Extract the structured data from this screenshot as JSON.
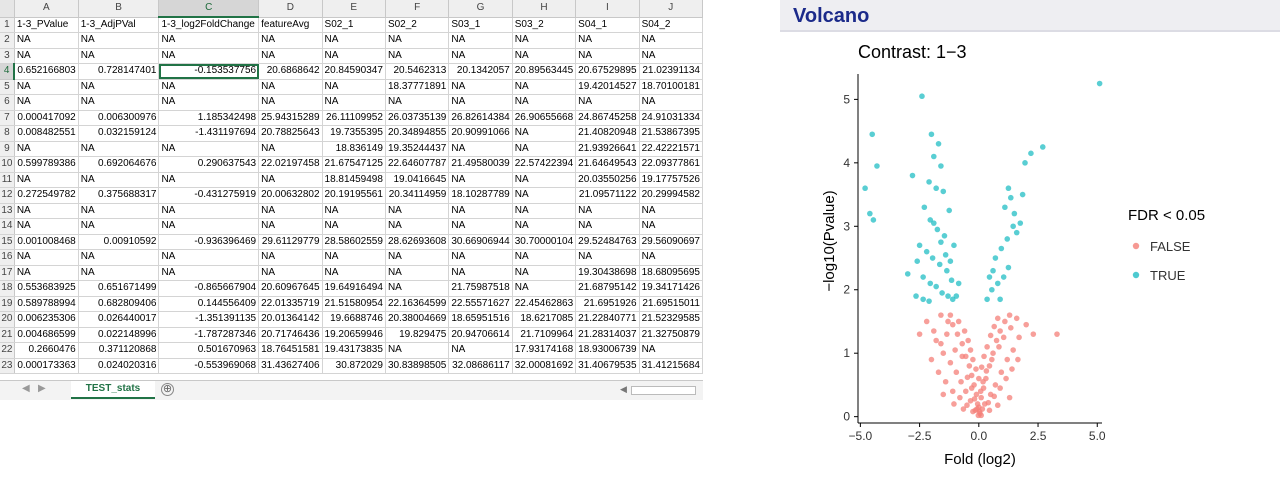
{
  "spreadsheet": {
    "columns": [
      "A",
      "B",
      "C",
      "D",
      "E",
      "F",
      "G",
      "H",
      "I",
      "J"
    ],
    "active_cell": "C4",
    "rows": [
      [
        "1-3_PValue",
        "1-3_AdjPVal",
        "1-3_log2FoldChange",
        "featureAvg",
        "S02_1",
        "S02_2",
        "S03_1",
        "S03_2",
        "S04_1",
        "S04_2"
      ],
      [
        "NA",
        "NA",
        "NA",
        "NA",
        "NA",
        "NA",
        "NA",
        "NA",
        "NA",
        "NA"
      ],
      [
        "NA",
        "NA",
        "NA",
        "NA",
        "NA",
        "NA",
        "NA",
        "NA",
        "NA",
        "NA"
      ],
      [
        "0.652166803",
        "0.728147401",
        "-0.153537756",
        "20.6868642",
        "20.84590347",
        "20.5462313",
        "20.1342057",
        "20.89563445",
        "20.67529895",
        "21.02391134"
      ],
      [
        "NA",
        "NA",
        "NA",
        "NA",
        "NA",
        "18.37771891",
        "NA",
        "NA",
        "19.42014527",
        "18.70100181"
      ],
      [
        "NA",
        "NA",
        "NA",
        "NA",
        "NA",
        "NA",
        "NA",
        "NA",
        "NA",
        "NA"
      ],
      [
        "0.000417092",
        "0.006300976",
        "1.185342498",
        "25.94315289",
        "26.11109952",
        "26.03735139",
        "26.82614384",
        "26.90655668",
        "24.86745258",
        "24.91031334"
      ],
      [
        "0.008482551",
        "0.032159124",
        "-1.431197694",
        "20.78825643",
        "19.7355395",
        "20.34894855",
        "20.90991066",
        "NA",
        "21.40820948",
        "21.53867395"
      ],
      [
        "NA",
        "NA",
        "NA",
        "NA",
        "18.836149",
        "19.35244437",
        "NA",
        "NA",
        "21.93926641",
        "22.42221571"
      ],
      [
        "0.599789386",
        "0.692064676",
        "0.290637543",
        "22.02197458",
        "21.67547125",
        "22.64607787",
        "21.49580039",
        "22.57422394",
        "21.64649543",
        "22.09377861"
      ],
      [
        "NA",
        "NA",
        "NA",
        "NA",
        "18.81459498",
        "19.0416645",
        "NA",
        "NA",
        "20.03550256",
        "19.17757526"
      ],
      [
        "0.272549782",
        "0.375688317",
        "-0.431275919",
        "20.00632802",
        "20.19195561",
        "20.34114959",
        "18.10287789",
        "NA",
        "21.09571122",
        "20.29994582"
      ],
      [
        "NA",
        "NA",
        "NA",
        "NA",
        "NA",
        "NA",
        "NA",
        "NA",
        "NA",
        "NA"
      ],
      [
        "NA",
        "NA",
        "NA",
        "NA",
        "NA",
        "NA",
        "NA",
        "NA",
        "NA",
        "NA"
      ],
      [
        "0.001008468",
        "0.00910592",
        "-0.936396469",
        "29.61129779",
        "28.58602559",
        "28.62693608",
        "30.66906944",
        "30.70000104",
        "29.52484763",
        "29.56090697"
      ],
      [
        "NA",
        "NA",
        "NA",
        "NA",
        "NA",
        "NA",
        "NA",
        "NA",
        "NA",
        "NA"
      ],
      [
        "NA",
        "NA",
        "NA",
        "NA",
        "NA",
        "NA",
        "NA",
        "NA",
        "19.30438698",
        "18.68095695"
      ],
      [
        "0.553683925",
        "0.651671499",
        "-0.865667904",
        "20.60967645",
        "19.64916494",
        "NA",
        "21.75987518",
        "NA",
        "21.68795142",
        "19.34171426"
      ],
      [
        "0.589788994",
        "0.682809406",
        "0.144556409",
        "22.01335719",
        "21.51580954",
        "22.16364599",
        "22.55571627",
        "22.45462863",
        "21.6951926",
        "21.69515011"
      ],
      [
        "0.006235306",
        "0.026440017",
        "-1.351391135",
        "20.01364142",
        "19.6688746",
        "20.38004669",
        "18.65951516",
        "18.6217085",
        "21.22840771",
        "21.52329585"
      ],
      [
        "0.004686599",
        "0.022148996",
        "-1.787287346",
        "20.71746436",
        "19.20659946",
        "19.829475",
        "20.94706614",
        "21.7109964",
        "21.28314037",
        "21.32750879"
      ],
      [
        "0.2660476",
        "0.371120868",
        "0.501670963",
        "18.76451581",
        "19.43173835",
        "NA",
        "NA",
        "17.93174168",
        "18.93006739",
        "NA"
      ],
      [
        "0.000173363",
        "0.024020316",
        "-0.553969068",
        "31.43627406",
        "30.872029",
        "30.83898505",
        "32.08686117",
        "32.00081692",
        "31.40679535",
        "31.41215684"
      ]
    ],
    "sheet_tab": "TEST_stats",
    "add_sheet_icon": "⊕"
  },
  "panel": {
    "title": "Volcano",
    "accent": "#1b2a8a"
  },
  "chart_data": {
    "type": "scatter",
    "title": "Contrast: 1−3",
    "xlabel": "Fold (log2)",
    "ylabel": "−log10(Pvalue)",
    "xlim": [
      -5.1,
      5.2
    ],
    "ylim": [
      -0.1,
      5.4
    ],
    "xticks": [
      -5.0,
      -2.5,
      0.0,
      2.5,
      5.0
    ],
    "xtick_labels": [
      "−5.0",
      "−2.5",
      "0.0",
      "2.5",
      "5.0"
    ],
    "yticks": [
      0,
      1,
      2,
      3,
      4,
      5
    ],
    "legend_title": "FDR < 0.05",
    "legend_position": "right",
    "series": [
      {
        "name": "FALSE",
        "color": "#f47f78",
        "points": [
          [
            -1.6,
            1.6
          ],
          [
            -1.3,
            1.5
          ],
          [
            -1.1,
            1.45
          ],
          [
            -0.9,
            1.3
          ],
          [
            -0.7,
            1.15
          ],
          [
            -0.55,
            0.95
          ],
          [
            -0.4,
            0.8
          ],
          [
            -0.3,
            0.65
          ],
          [
            -0.2,
            0.5
          ],
          [
            -0.1,
            0.35
          ],
          [
            0.0,
            0.15
          ],
          [
            0.1,
            0.3
          ],
          [
            0.2,
            0.45
          ],
          [
            0.3,
            0.6
          ],
          [
            0.45,
            0.8
          ],
          [
            0.6,
            1.0
          ],
          [
            0.75,
            1.2
          ],
          [
            0.9,
            1.35
          ],
          [
            1.1,
            1.5
          ],
          [
            1.3,
            1.6
          ],
          [
            -1.8,
            1.2
          ],
          [
            -1.5,
            1.0
          ],
          [
            -1.2,
            0.85
          ],
          [
            -0.95,
            0.7
          ],
          [
            -0.75,
            0.55
          ],
          [
            -0.55,
            0.4
          ],
          [
            -0.35,
            0.25
          ],
          [
            -0.15,
            0.1
          ],
          [
            0.05,
            0.05
          ],
          [
            0.25,
            0.2
          ],
          [
            0.5,
            0.35
          ],
          [
            0.7,
            0.5
          ],
          [
            0.95,
            0.7
          ],
          [
            1.2,
            0.9
          ],
          [
            1.45,
            1.05
          ],
          [
            1.7,
            1.25
          ],
          [
            -2.0,
            0.9
          ],
          [
            -1.7,
            0.7
          ],
          [
            -1.4,
            0.55
          ],
          [
            -1.1,
            0.4
          ],
          [
            -0.8,
            0.3
          ],
          [
            -0.5,
            0.18
          ],
          [
            -0.25,
            0.08
          ],
          [
            0.15,
            0.12
          ],
          [
            0.4,
            0.22
          ],
          [
            0.65,
            0.32
          ],
          [
            0.9,
            0.45
          ],
          [
            1.15,
            0.6
          ],
          [
            1.4,
            0.75
          ],
          [
            1.65,
            0.9
          ],
          [
            -1.2,
            1.6
          ],
          [
            -0.85,
            1.5
          ],
          [
            -0.6,
            1.35
          ],
          [
            -0.45,
            1.2
          ],
          [
            -0.35,
            1.05
          ],
          [
            -0.25,
            0.9
          ],
          [
            -0.12,
            0.75
          ],
          [
            0.0,
            0.6
          ],
          [
            0.12,
            0.78
          ],
          [
            0.22,
            0.95
          ],
          [
            0.35,
            1.1
          ],
          [
            0.5,
            1.28
          ],
          [
            0.65,
            1.42
          ],
          [
            0.8,
            1.55
          ],
          [
            -2.2,
            1.5
          ],
          [
            -1.9,
            1.35
          ],
          [
            -1.6,
            1.15
          ],
          [
            -1.35,
            1.3
          ],
          [
            -1.0,
            1.05
          ],
          [
            -0.7,
            0.95
          ],
          [
            -0.48,
            0.62
          ],
          [
            -0.3,
            0.45
          ],
          [
            -0.18,
            0.28
          ],
          [
            -0.05,
            0.2
          ],
          [
            0.08,
            0.4
          ],
          [
            0.18,
            0.55
          ],
          [
            0.32,
            0.72
          ],
          [
            0.55,
            0.9
          ],
          [
            0.85,
            1.1
          ],
          [
            1.05,
            1.25
          ],
          [
            1.35,
            1.4
          ],
          [
            1.6,
            1.55
          ],
          [
            2.0,
            1.45
          ],
          [
            2.3,
            1.3
          ],
          [
            3.3,
            1.3
          ],
          [
            -2.5,
            1.3
          ],
          [
            -1.05,
            0.2
          ],
          [
            -0.65,
            0.12
          ],
          [
            0.45,
            0.1
          ],
          [
            0.8,
            0.18
          ],
          [
            -1.5,
            0.35
          ],
          [
            1.3,
            0.3
          ],
          [
            -0.02,
            0.02
          ],
          [
            0.03,
            0.08
          ],
          [
            -0.08,
            0.12
          ],
          [
            0.1,
            0.02
          ]
        ]
      },
      {
        "name": "TRUE",
        "color": "#22bdc4",
        "points": [
          [
            5.1,
            5.25
          ],
          [
            -2.4,
            5.05
          ],
          [
            -4.5,
            4.45
          ],
          [
            -4.3,
            3.95
          ],
          [
            -4.8,
            3.6
          ],
          [
            -4.6,
            3.2
          ],
          [
            -4.45,
            3.1
          ],
          [
            -2.0,
            4.45
          ],
          [
            -1.7,
            4.3
          ],
          [
            -1.9,
            4.1
          ],
          [
            -1.6,
            3.95
          ],
          [
            -2.1,
            3.7
          ],
          [
            -1.8,
            3.6
          ],
          [
            -1.5,
            3.55
          ],
          [
            -2.3,
            3.3
          ],
          [
            -2.05,
            3.1
          ],
          [
            -1.75,
            2.95
          ],
          [
            -1.45,
            2.85
          ],
          [
            -2.5,
            2.7
          ],
          [
            -2.2,
            2.6
          ],
          [
            -1.95,
            2.5
          ],
          [
            -1.65,
            2.4
          ],
          [
            -1.35,
            2.3
          ],
          [
            -1.15,
            2.15
          ],
          [
            -2.35,
            2.2
          ],
          [
            -2.05,
            2.1
          ],
          [
            -1.8,
            2.05
          ],
          [
            -1.55,
            1.95
          ],
          [
            -1.3,
            1.9
          ],
          [
            -1.1,
            1.85
          ],
          [
            -2.65,
            1.9
          ],
          [
            -2.35,
            1.85
          ],
          [
            -2.1,
            1.82
          ],
          [
            -1.9,
            3.05
          ],
          [
            -1.6,
            2.75
          ],
          [
            -1.4,
            2.55
          ],
          [
            -1.2,
            2.45
          ],
          [
            -2.6,
            2.45
          ],
          [
            -3.0,
            2.25
          ],
          [
            -2.8,
            3.8
          ],
          [
            -1.25,
            3.25
          ],
          [
            -1.05,
            2.7
          ],
          [
            0.55,
            2.0
          ],
          [
            0.8,
            2.1
          ],
          [
            1.05,
            2.2
          ],
          [
            1.25,
            2.35
          ],
          [
            0.7,
            2.5
          ],
          [
            0.95,
            2.65
          ],
          [
            1.2,
            2.8
          ],
          [
            1.45,
            3.0
          ],
          [
            1.1,
            3.3
          ],
          [
            1.35,
            3.45
          ],
          [
            1.5,
            3.2
          ],
          [
            1.75,
            3.05
          ],
          [
            1.25,
            3.6
          ],
          [
            1.95,
            4.0
          ],
          [
            2.2,
            4.15
          ],
          [
            2.7,
            4.25
          ],
          [
            0.45,
            2.2
          ],
          [
            0.6,
            2.3
          ],
          [
            1.6,
            2.9
          ],
          [
            1.85,
            3.5
          ],
          [
            0.35,
            1.85
          ],
          [
            0.9,
            1.85
          ],
          [
            -0.95,
            1.9
          ],
          [
            -0.85,
            2.1
          ]
        ]
      }
    ]
  }
}
